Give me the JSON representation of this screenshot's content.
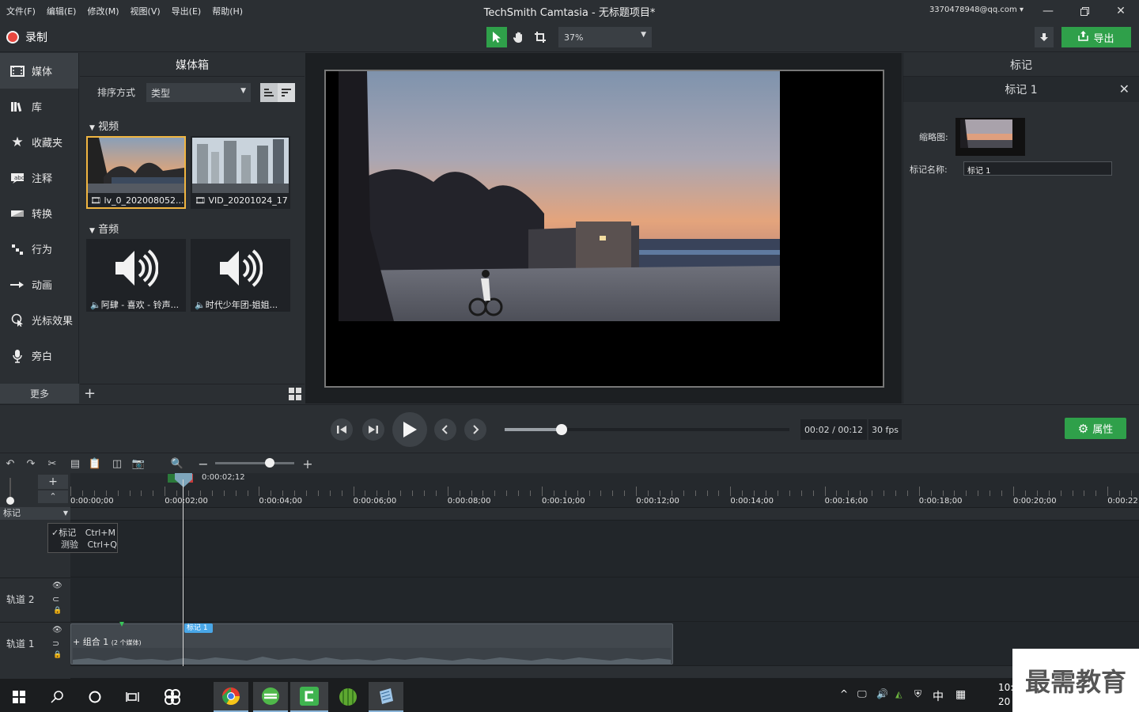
{
  "menu": [
    "文件(F)",
    "编辑(E)",
    "修改(M)",
    "视图(V)",
    "导出(E)",
    "帮助(H)"
  ],
  "window": {
    "title": "TechSmith Camtasia - 无标题项目*",
    "account": "3370478948@qq.com ▾"
  },
  "toolbar": {
    "record": "录制",
    "zoom": "37%",
    "export": "导出"
  },
  "nav": {
    "items": [
      {
        "label": "媒体",
        "icon": "film-icon"
      },
      {
        "label": "库",
        "icon": "library-icon"
      },
      {
        "label": "收藏夹",
        "icon": "star-icon"
      },
      {
        "label": "注释",
        "icon": "annotation-icon"
      },
      {
        "label": "转换",
        "icon": "transition-icon"
      },
      {
        "label": "行为",
        "icon": "behavior-icon"
      },
      {
        "label": "动画",
        "icon": "animation-icon"
      },
      {
        "label": "光标效果",
        "icon": "cursor-icon"
      },
      {
        "label": "旁白",
        "icon": "microphone-icon"
      }
    ],
    "more": "更多"
  },
  "media_bin": {
    "title": "媒体箱",
    "sort_label": "排序方式",
    "sort_value": "类型",
    "video_section": "视频",
    "audio_section": "音频",
    "videos": [
      "lv_0_202008052...",
      "VID_20201024_17..."
    ],
    "audios": [
      "阿肆 - 喜欢 - 铃声...",
      "时代少年团-姐姐..."
    ]
  },
  "properties_panel": {
    "title": "标记",
    "marker_title": "标记 1",
    "thumb_label": "缩略图:",
    "name_label": "标记名称:",
    "name_value": "标记 1"
  },
  "player": {
    "time": "00:02 / 00:12",
    "fps": "30 fps",
    "properties": "属性",
    "progress": 0.2
  },
  "timeline": {
    "playhead_time": "0:00:02;12",
    "ticks": [
      "0:00:00;00",
      "0:00:02;00",
      "0:00:04;00",
      "0:00:06;00",
      "0:00:08;00",
      "0:00:10;00",
      "0:00:12;00",
      "0:00:14;00",
      "0:00:16;00",
      "0:00:18;00",
      "0:00:20;00",
      "0:00:22"
    ],
    "marker_dropdown": "标记",
    "menu": [
      {
        "label": "标记",
        "shortcut": "Ctrl+M"
      },
      {
        "label": "测验",
        "shortcut": "Ctrl+Q"
      }
    ],
    "track2": "轨道 2",
    "track1": "轨道 1",
    "marker_chip": "标记 1",
    "clip_label": "组合 1",
    "clip_sub": "(2 个媒体)"
  },
  "taskbar": {
    "ime": "中",
    "clock1": "10:",
    "clock2": "20"
  },
  "watermark": "最需教育"
}
